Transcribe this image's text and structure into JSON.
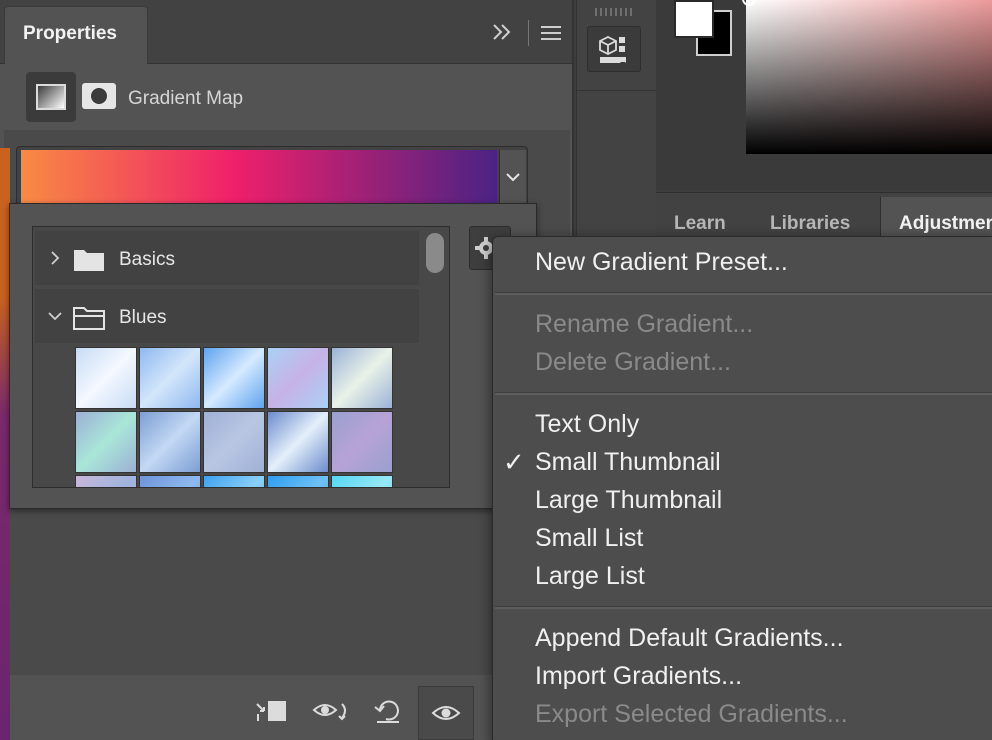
{
  "properties_panel": {
    "tab_title": "Properties",
    "adjustment_name": "Gradient Map",
    "gradient_colors": [
      "#f88b43",
      "#ef1f6a",
      "#4b2384"
    ]
  },
  "gradient_picker": {
    "folders": [
      {
        "label": "Basics",
        "expanded": false
      },
      {
        "label": "Blues",
        "expanded": true
      }
    ],
    "swatches": [
      [
        "#c8dcf5",
        "#f4f8ff"
      ],
      [
        "#8fb8f0",
        "#d3e6fb"
      ],
      [
        "#5fa4ef",
        "#d6eaff"
      ],
      [
        "#a9d1f6",
        "#c7b2e6"
      ],
      [
        "#9bb2d8",
        "#e9f2e8"
      ],
      [
        "#9db0d6",
        "#a9e6d8"
      ],
      [
        "#7d9ed4",
        "#c2d8f4"
      ],
      [
        "#9fb1d6",
        "#b9c6e3"
      ],
      [
        "#6c8ccc",
        "#e4f0fb"
      ],
      [
        "#9aa0cf",
        "#b7a2d6"
      ],
      [
        "#c9b7d9",
        "#9fb4de"
      ],
      [
        "#6e93da",
        "#8eb9ef"
      ],
      [
        "#3ea0ef",
        "#8bd0f8"
      ],
      [
        "#2f9cf0",
        "#6fc1f5"
      ],
      [
        "#55d6f2",
        "#96e8f5"
      ]
    ]
  },
  "context_menu": {
    "new_preset": "New Gradient Preset...",
    "rename": "Rename Gradient...",
    "delete": "Delete Gradient...",
    "text_only": "Text Only",
    "small_thumbnail": "Small Thumbnail",
    "large_thumbnail": "Large Thumbnail",
    "small_list": "Small List",
    "large_list": "Large List",
    "append_default": "Append Default Gradients...",
    "import": "Import Gradients...",
    "export_selected": "Export Selected Gradients...",
    "check_glyph": "✓",
    "selected_view": "Small Thumbnail"
  },
  "right_panel": {
    "tabs": [
      "Learn",
      "Libraries",
      "Adjustments"
    ],
    "foreground_color": "#ffffff",
    "background_color": "#000000"
  }
}
